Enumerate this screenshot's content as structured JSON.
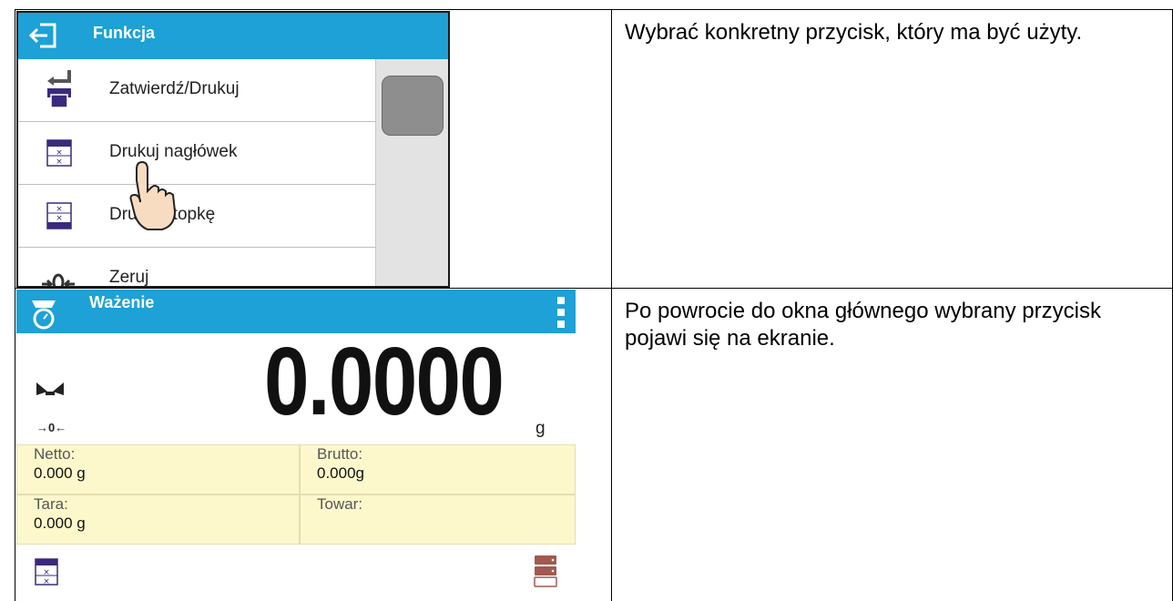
{
  "rows": [
    {
      "screen": {
        "header_title": "Funkcja",
        "menu_items": [
          {
            "label": "Zatwierdź/Drukuj",
            "icon": "print-confirm-icon"
          },
          {
            "label": "Drukuj nagłówek",
            "icon": "print-header-icon"
          },
          {
            "label": "Drukuj stopkę",
            "icon": "print-footer-icon"
          },
          {
            "label": "Zeruj",
            "icon": "zero-icon"
          }
        ]
      },
      "description": "Wybrać konkretny przycisk, który ma być użyty."
    },
    {
      "screen": {
        "header_title": "Ważenie",
        "main_value": "0.0000",
        "unit": "g",
        "info": [
          {
            "key": "Netto:",
            "value": "0.000 g"
          },
          {
            "key": "Brutto:",
            "value": "0.000g"
          },
          {
            "key": "Tara:",
            "value": "0.000 g"
          },
          {
            "key": "Towar:",
            "value": ""
          }
        ],
        "zero_indicator": "→0←"
      },
      "description": "Po powrocie do okna głównego wybrany przycisk pojawi się na ekranie."
    }
  ],
  "colors": {
    "header": "#1da1d6",
    "icon_purple": "#3a2a7c",
    "info_bg": "#fdf8cc"
  }
}
